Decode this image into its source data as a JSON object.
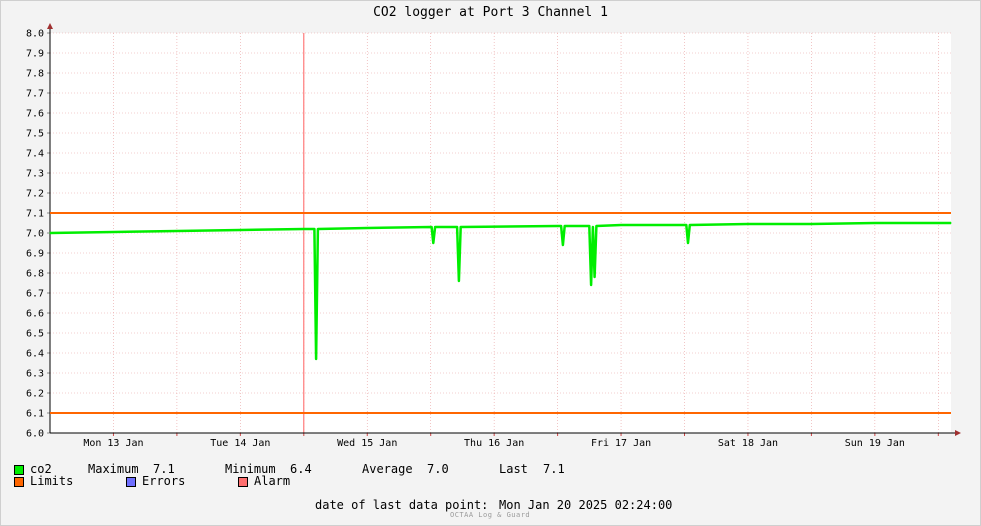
{
  "chart_data": {
    "type": "line",
    "title": "CO2 logger at Port 3 Channel 1",
    "xlabel": "",
    "ylabel": "",
    "x_range": [
      "2025-01-13 00:00",
      "2025-01-20 02:24"
    ],
    "x_ticks": [
      "Mon 13 Jan",
      "Tue 14 Jan",
      "Wed 15 Jan",
      "Thu 16 Jan",
      "Fri 17 Jan",
      "Sat 18 Jan",
      "Sun 19 Jan"
    ],
    "ylim": [
      6.0,
      8.0
    ],
    "y_ticks": [
      "6.0",
      "6.1",
      "6.2",
      "6.3",
      "6.4",
      "6.5",
      "6.6",
      "6.7",
      "6.8",
      "6.9",
      "7.0",
      "7.1",
      "7.2",
      "7.3",
      "7.4",
      "7.5",
      "7.6",
      "7.7",
      "7.8",
      "7.9",
      "8.0"
    ],
    "grid": true,
    "series": [
      {
        "name": "co2",
        "color": "#00ee00",
        "points": [
          [
            "2025-01-13 00:00",
            7.0
          ],
          [
            "2025-01-13 12:00",
            7.005
          ],
          [
            "2025-01-14 00:00",
            7.01
          ],
          [
            "2025-01-14 12:00",
            7.015
          ],
          [
            "2025-01-15 00:00",
            7.02
          ],
          [
            "2025-01-15 02:00",
            7.02
          ],
          [
            "2025-01-15 02:20",
            6.37
          ],
          [
            "2025-01-15 02:40",
            7.02
          ],
          [
            "2025-01-15 12:00",
            7.025
          ],
          [
            "2025-01-16 00:00",
            7.03
          ],
          [
            "2025-01-16 00:10",
            7.03
          ],
          [
            "2025-01-16 00:30",
            6.95
          ],
          [
            "2025-01-16 00:50",
            7.03
          ],
          [
            "2025-01-16 05:00",
            7.03
          ],
          [
            "2025-01-16 05:20",
            6.76
          ],
          [
            "2025-01-16 05:40",
            7.03
          ],
          [
            "2025-01-17 00:00",
            7.035
          ],
          [
            "2025-01-17 00:40",
            7.035
          ],
          [
            "2025-01-17 01:00",
            6.94
          ],
          [
            "2025-01-17 01:20",
            7.035
          ],
          [
            "2025-01-17 06:00",
            7.035
          ],
          [
            "2025-01-17 06:20",
            6.74
          ],
          [
            "2025-01-17 06:40",
            7.03
          ],
          [
            "2025-01-17 07:00",
            6.78
          ],
          [
            "2025-01-17 07:20",
            7.035
          ],
          [
            "2025-01-17 12:00",
            7.04
          ],
          [
            "2025-01-18 00:00",
            7.04
          ],
          [
            "2025-01-18 00:20",
            7.04
          ],
          [
            "2025-01-18 00:40",
            6.95
          ],
          [
            "2025-01-18 01:00",
            7.04
          ],
          [
            "2025-01-18 12:00",
            7.045
          ],
          [
            "2025-01-19 00:00",
            7.045
          ],
          [
            "2025-01-19 12:00",
            7.05
          ],
          [
            "2025-01-20 02:24",
            7.05
          ]
        ]
      }
    ],
    "limits": {
      "upper": 7.1,
      "lower": 6.1,
      "color": "#ff6600"
    }
  },
  "legend": {
    "co2_label": "co2",
    "maximum_label": "Maximum",
    "maximum_value": "7.1",
    "minimum_label": "Minimum",
    "minimum_value": "6.4",
    "average_label": "Average",
    "average_value": "7.0",
    "last_label": "Last",
    "last_value": "7.1",
    "limits_label": "Limits",
    "errors_label": "Errors",
    "alarm_label": "Alarm",
    "colors": {
      "co2": "#00ee00",
      "limits": "#ff6600",
      "errors": "#6f6fff",
      "alarm": "#ff6f6f"
    }
  },
  "footer": {
    "last_point_label": "date of last data point:",
    "last_point_value": "Mon Jan 20 2025 02:24:00",
    "brand": "OCTAA Log & Guard"
  }
}
